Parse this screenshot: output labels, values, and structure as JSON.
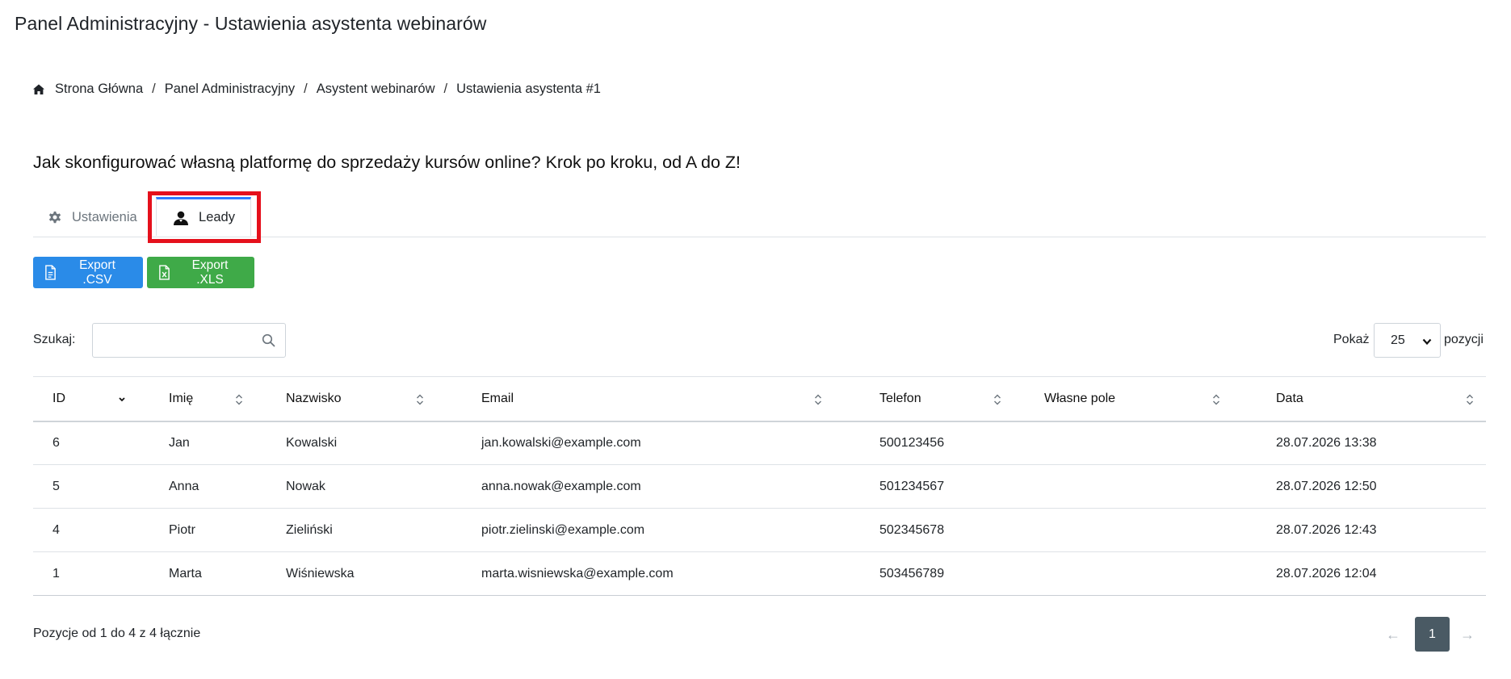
{
  "app": {
    "title": "Panel Administracyjny - Ustawienia asystenta webinarów"
  },
  "breadcrumb": {
    "items": [
      "Strona Główna",
      "Panel Administracyjny",
      "Asystent webinarów",
      "Ustawienia asystenta #1"
    ],
    "separator": "/"
  },
  "page": {
    "title": "Jak skonfigurować własną platformę do sprzedaży kursów online? Krok po kroku, od A do Z!"
  },
  "tabs": [
    {
      "label": "Ustawienia",
      "icon": "gear-icon",
      "active": false
    },
    {
      "label": "Leady",
      "icon": "user-icon",
      "active": true
    }
  ],
  "toolbar": {
    "export_csv_label": "Export .CSV",
    "export_xls_label": "Export .XLS"
  },
  "search": {
    "label": "Szukaj:",
    "value": "",
    "placeholder": ""
  },
  "page_size": {
    "label_before": "Pokaż",
    "value": "25",
    "label_after": "pozycji"
  },
  "table": {
    "columns": [
      "ID",
      "Imię",
      "Nazwisko",
      "Email",
      "Telefon",
      "Własne pole",
      "Data"
    ],
    "rows": [
      [
        "6",
        "Jan",
        "Kowalski",
        "jan.kowalski@example.com",
        "500123456",
        "",
        "28.07.2026 13:38"
      ],
      [
        "5",
        "Anna",
        "Nowak",
        "anna.nowak@example.com",
        "501234567",
        "",
        "28.07.2026 12:50"
      ],
      [
        "4",
        "Piotr",
        "Zieliński",
        "piotr.zielinski@example.com",
        "502345678",
        "",
        "28.07.2026 12:43"
      ],
      [
        "1",
        "Marta",
        "Wiśniewska",
        "marta.wisniewska@example.com",
        "503456789",
        "",
        "28.07.2026 12:04"
      ]
    ]
  },
  "footer": {
    "info": "Pozycje od 1 do 4 z 4 łącznie"
  },
  "pagination": {
    "prev": "←",
    "current": "1",
    "next": "→"
  },
  "colors": {
    "primary": "#2a8be8",
    "success": "#3faa48",
    "highlight": "#e5101c",
    "active_tab_accent": "#2f7bff",
    "pager_active": "#4a5a64"
  }
}
